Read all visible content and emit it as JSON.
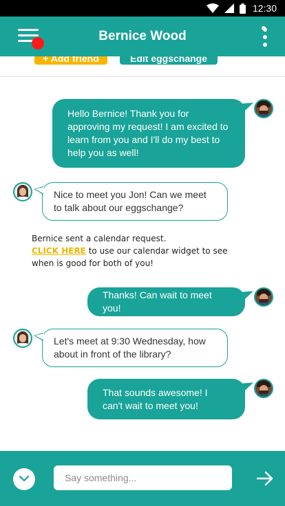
{
  "status_bar": {
    "time": "12:30"
  },
  "header": {
    "title": "Bernice Wood"
  },
  "sub_toolbar": {
    "add_friend_label": "+ Add friend",
    "edit_label": "Edit eggschange"
  },
  "messages": [
    {
      "from": "Jon",
      "direction": "out",
      "text": "Hello Bernice! Thank you for approving my request! I am excited to learn from you and I'll do my best to help you as well!"
    },
    {
      "from": "Bernice",
      "direction": "in",
      "text": "Nice to meet you Jon! Can we meet to talk about our eggschange?"
    },
    {
      "from": "Jon",
      "direction": "out",
      "text": "Thanks! Can wait to meet you!"
    },
    {
      "from": "Bernice",
      "direction": "in",
      "text": "Let's meet at 9:30 Wednesday, how about in front of the library?"
    },
    {
      "from": "Jon",
      "direction": "out",
      "text": "That sounds awesome! I can't wait to meet you!"
    }
  ],
  "system_note": {
    "line1": "Bernice sent a calendar request.",
    "link": "CLICK HERE",
    "rest": " to use our calendar widget to see when is good for both of you!"
  },
  "composer": {
    "placeholder": "Say something..."
  },
  "icons": {
    "menu": "hamburger-menu-icon",
    "more": "more-vertical-icon",
    "scroll": "chevron-down-icon",
    "send": "arrow-right-icon",
    "notification_dot": "red-notification-dot"
  },
  "colors": {
    "accent": "#19a399",
    "link": "#f2b500",
    "notification": "#ff1a1a"
  }
}
